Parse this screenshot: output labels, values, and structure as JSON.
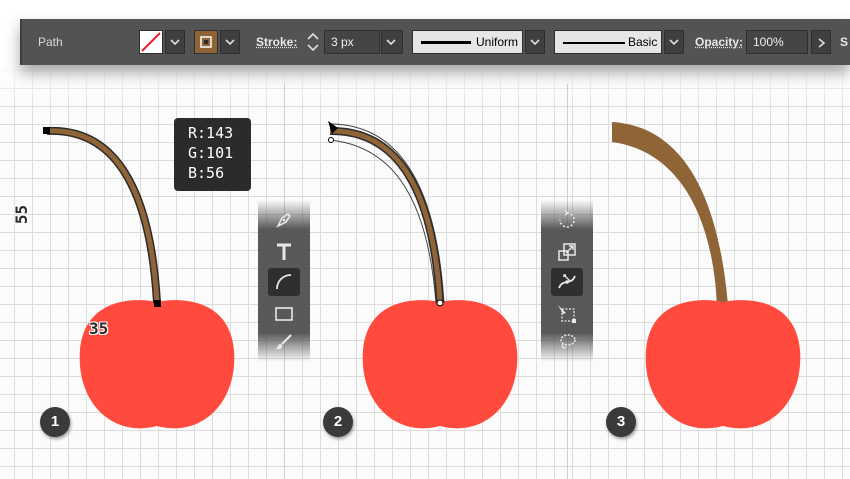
{
  "control_bar": {
    "selection_label": "Path",
    "stroke_label": "Stroke:",
    "stroke_weight": "3 px",
    "profile_label": "Uniform",
    "brush_label": "Basic",
    "opacity_label": "Opacity:",
    "opacity_value": "100%",
    "overflow_label": "S",
    "stroke_color": "#8f6538"
  },
  "tooltip": {
    "r": "R:143",
    "g": "G:101",
    "b": "B:56"
  },
  "dimensions": {
    "stem_height": "55",
    "stem_offset": "35"
  },
  "colors": {
    "cherry": "#ff4a3d",
    "stem": "#8f6538",
    "control_bar": "#535353"
  },
  "tool_strip_1": [
    "pen-tool-icon",
    "type-tool-icon",
    "arc-tool-icon",
    "rectangle-tool-icon",
    "paintbrush-tool-icon"
  ],
  "tool_strip_2": [
    "rotate-tool-icon",
    "scale-tool-icon",
    "width-tool-icon",
    "free-transform-tool-icon",
    "lasso-tool-icon"
  ],
  "steps": [
    "1",
    "2",
    "3"
  ]
}
